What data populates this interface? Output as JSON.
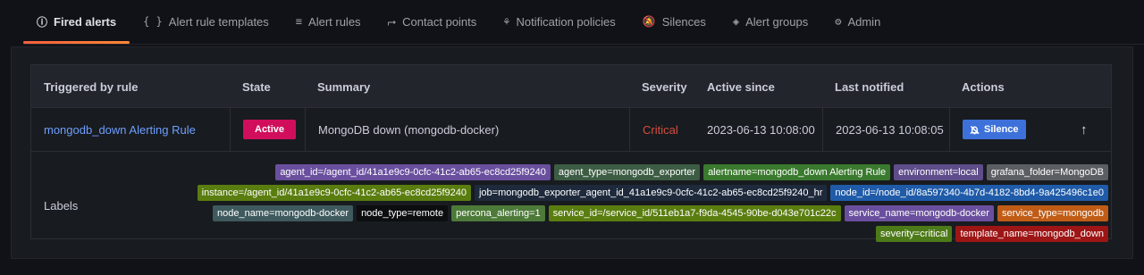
{
  "tabs": [
    {
      "label": "Fired alerts",
      "icon": "info-circle-icon",
      "glyph": "ⓘ",
      "active": true
    },
    {
      "label": "Alert rule templates",
      "icon": "brackets-icon",
      "glyph": "{ }"
    },
    {
      "label": "Alert rules",
      "icon": "list-icon",
      "glyph": "≡"
    },
    {
      "label": "Contact points",
      "icon": "contact-icon",
      "glyph": "⮣"
    },
    {
      "label": "Notification policies",
      "icon": "sitemap-icon",
      "glyph": "⚘"
    },
    {
      "label": "Silences",
      "icon": "bell-slash-icon",
      "glyph": "🔕"
    },
    {
      "label": "Alert groups",
      "icon": "layers-icon",
      "glyph": "◈"
    },
    {
      "label": "Admin",
      "icon": "cog-icon",
      "glyph": "⚙"
    }
  ],
  "table": {
    "headers": {
      "rule": "Triggered by rule",
      "state": "State",
      "summary": "Summary",
      "severity": "Severity",
      "active_since": "Active since",
      "last_notified": "Last notified",
      "actions": "Actions"
    },
    "row": {
      "rule": "mongodb_down Alerting Rule",
      "state": "Active",
      "summary": "MongoDB down (mongodb-docker)",
      "severity": "Critical",
      "active_since": "2023-06-13 10:08:00",
      "last_notified": "2023-06-13 10:08:05",
      "silence_label": "Silence",
      "expand_icon": "arrow-up-icon"
    },
    "labels_title": "Labels",
    "labels": [
      {
        "text": "agent_id=/agent_id/41a1e9c9-0cfc-41c2-ab65-ec8cd25f9240",
        "color": "#6a4f9e"
      },
      {
        "text": "agent_type=mongodb_exporter",
        "color": "#3d5c44"
      },
      {
        "text": "alertname=mongodb_down Alerting Rule",
        "color": "#3a7a2e"
      },
      {
        "text": "environment=local",
        "color": "#5e4d8a"
      },
      {
        "text": "grafana_folder=MongoDB",
        "color": "#5b5e62"
      },
      {
        "text": "instance=/agent_id/41a1e9c9-0cfc-41c2-ab65-ec8cd25f9240",
        "color": "#5a7d0f"
      },
      {
        "text": "job=mongodb_exporter_agent_id_41a1e9c9-0cfc-41c2-ab65-ec8cd25f9240_hr",
        "color": "#1e2a3c"
      },
      {
        "text": "node_id=/node_id/8a597340-4b7d-4182-8bd4-9a425496c1e0",
        "color": "#1f5ba8"
      },
      {
        "text": "node_name=mongodb-docker",
        "color": "#3e5a5e"
      },
      {
        "text": "node_type=remote",
        "color": "#0d0e10"
      },
      {
        "text": "percona_alerting=1",
        "color": "#4d7a39"
      },
      {
        "text": "service_id=/service_id/511eb1a7-f9da-4545-90be-d043e701c22c",
        "color": "#5a7d0f"
      },
      {
        "text": "service_name=mongodb-docker",
        "color": "#6a4f9e"
      },
      {
        "text": "service_type=mongodb",
        "color": "#c05c16"
      },
      {
        "text": "severity=critical",
        "color": "#4d7a19"
      },
      {
        "text": "template_name=mongodb_down",
        "color": "#9e1515"
      }
    ]
  },
  "colors": {
    "accent": "#f55f3e",
    "link": "#6e9fff",
    "state_active": "#d10e5c",
    "critical": "#d74d3f",
    "silence_button": "#3d71d9"
  }
}
